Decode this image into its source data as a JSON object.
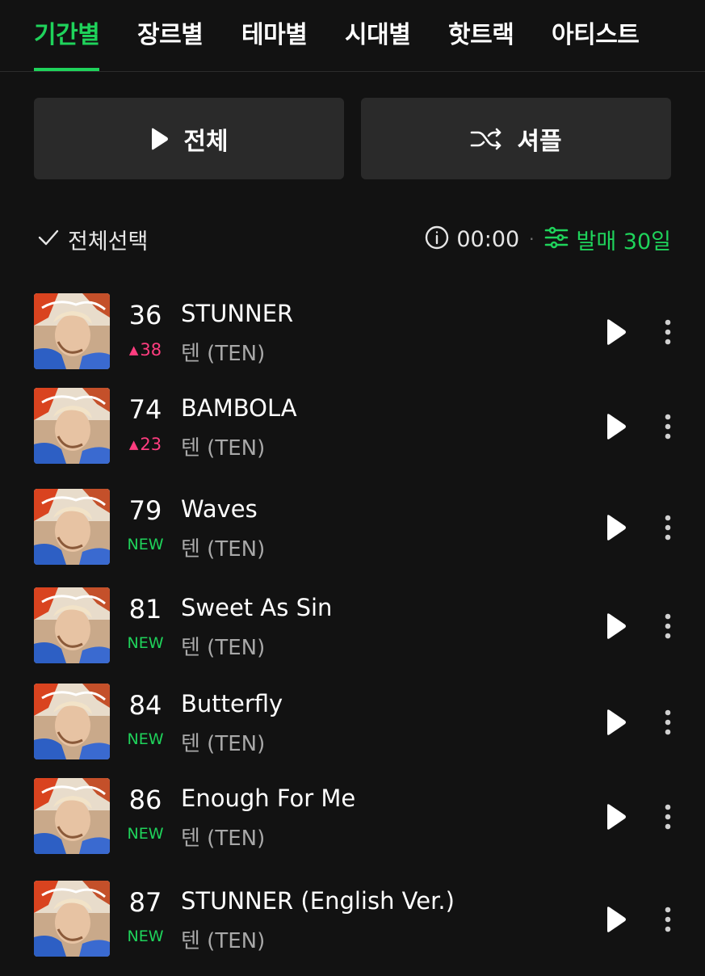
{
  "tabs": [
    {
      "label": "기간별",
      "active": true
    },
    {
      "label": "장르별",
      "active": false
    },
    {
      "label": "테마별",
      "active": false
    },
    {
      "label": "시대별",
      "active": false
    },
    {
      "label": "핫트랙",
      "active": false
    },
    {
      "label": "아티스트",
      "active": false
    }
  ],
  "actions": {
    "play_all_label": "전체",
    "shuffle_label": "셔플"
  },
  "toolbar": {
    "select_all_label": "전체선택",
    "duration": "00:00",
    "filter_label": "발매 30일"
  },
  "colors": {
    "accent": "#1fd35b",
    "rank_up": "#ff3d7f",
    "background": "#121212",
    "button_bg": "#2a2a2a"
  },
  "icons": {
    "play_all": "play-icon",
    "shuffle": "shuffle-icon",
    "select_all": "check-icon",
    "info": "info-icon",
    "filter": "sliders-icon",
    "row_play": "play-icon",
    "row_more": "more-vertical-icon"
  },
  "tracks": [
    {
      "rank": "36",
      "change": "38",
      "change_type": "up",
      "title": "STUNNER",
      "artist": "텐 (TEN)"
    },
    {
      "rank": "74",
      "change": "23",
      "change_type": "up",
      "title": "BAMBOLA",
      "artist": "텐 (TEN)"
    },
    {
      "rank": "79",
      "change": "NEW",
      "change_type": "new",
      "title": "Waves",
      "artist": "텐 (TEN)"
    },
    {
      "rank": "81",
      "change": "NEW",
      "change_type": "new",
      "title": "Sweet As Sin",
      "artist": "텐 (TEN)"
    },
    {
      "rank": "84",
      "change": "NEW",
      "change_type": "new",
      "title": "Butterfly",
      "artist": "텐 (TEN)"
    },
    {
      "rank": "86",
      "change": "NEW",
      "change_type": "new",
      "title": "Enough For Me",
      "artist": "텐 (TEN)"
    },
    {
      "rank": "87",
      "change": "NEW",
      "change_type": "new",
      "title": "STUNNER (English Ver.)",
      "artist": "텐 (TEN)"
    }
  ]
}
